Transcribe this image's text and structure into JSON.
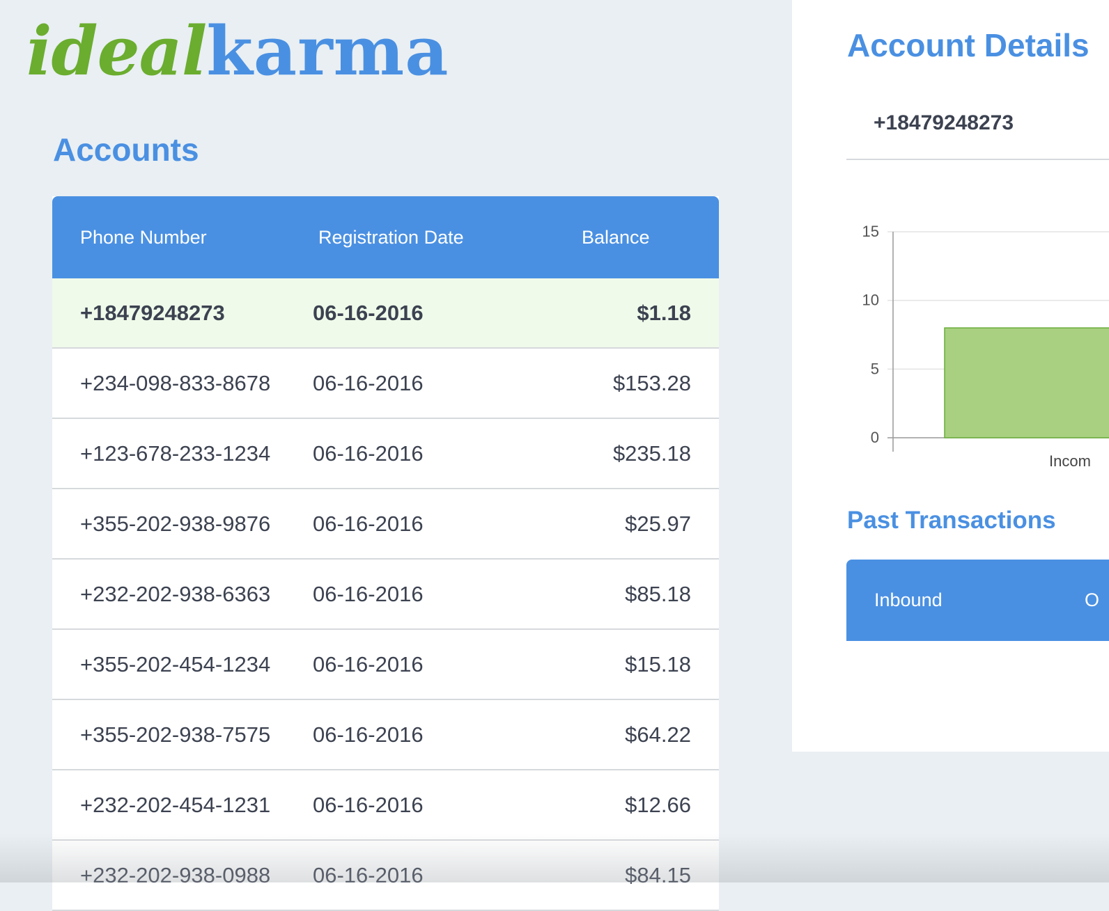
{
  "logo": {
    "part1": "ideal",
    "part2": "karma"
  },
  "accounts": {
    "title": "Accounts",
    "columns": [
      "Phone Number",
      "Registration Date",
      "Balance"
    ],
    "rows": [
      {
        "phone": "+18479248273",
        "date": "06-16-2016",
        "balance": "$1.18",
        "selected": true
      },
      {
        "phone": "+234-098-833-8678",
        "date": "06-16-2016",
        "balance": "$153.28"
      },
      {
        "phone": "+123-678-233-1234",
        "date": "06-16-2016",
        "balance": "$235.18"
      },
      {
        "phone": "+355-202-938-9876",
        "date": "06-16-2016",
        "balance": "$25.97"
      },
      {
        "phone": "+232-202-938-6363",
        "date": "06-16-2016",
        "balance": "$85.18"
      },
      {
        "phone": "+355-202-454-1234",
        "date": "06-16-2016",
        "balance": "$15.18"
      },
      {
        "phone": "+355-202-938-7575",
        "date": "06-16-2016",
        "balance": "$64.22"
      },
      {
        "phone": "+232-202-454-1231",
        "date": "06-16-2016",
        "balance": "$12.66"
      },
      {
        "phone": "+232-202-938-0988",
        "date": "06-16-2016",
        "balance": "$84.15"
      }
    ]
  },
  "details": {
    "title": "Account Details",
    "phone": "+18479248273",
    "past_transactions_title": "Past Transactions",
    "transaction_columns": [
      "Inbound",
      "O"
    ]
  },
  "chart_data": {
    "type": "bar",
    "categories": [
      "Incom"
    ],
    "series": [
      {
        "values": [
          8
        ],
        "color": "#a8d080"
      }
    ],
    "yticks": [
      0,
      5,
      10,
      15
    ],
    "ylim": [
      0,
      15
    ],
    "grid": true
  }
}
